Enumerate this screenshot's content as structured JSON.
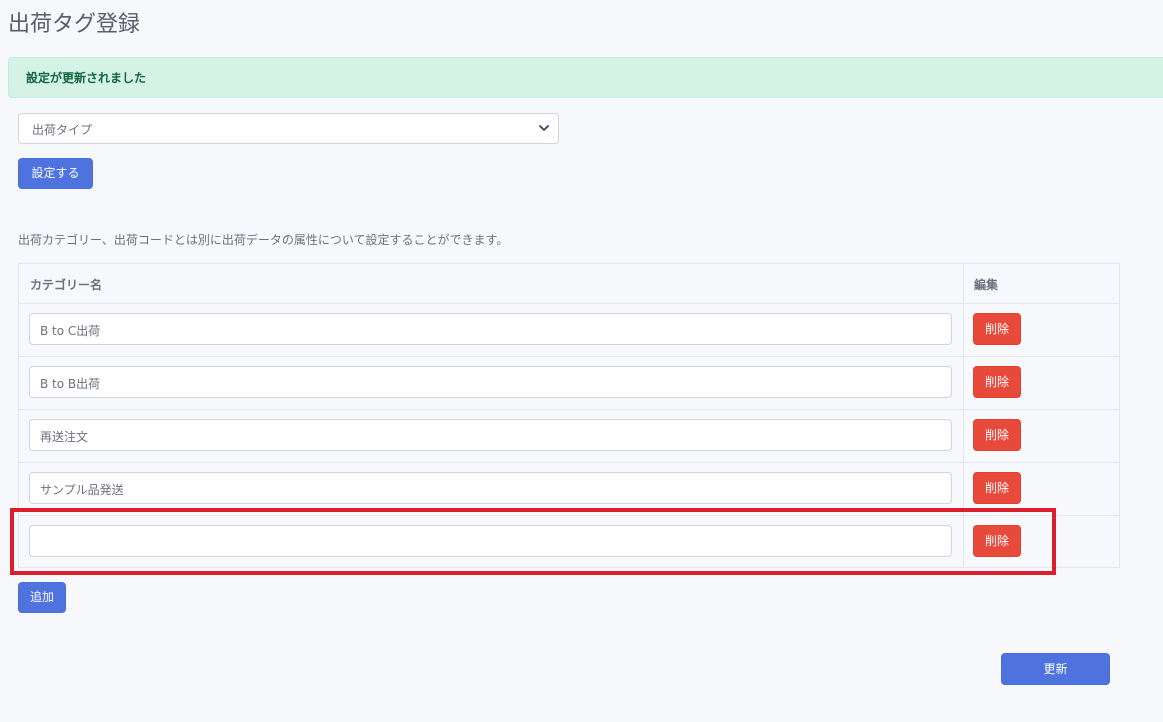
{
  "page": {
    "title": "出荷タグ登録"
  },
  "alert": {
    "message": "設定が更新されました"
  },
  "select": {
    "selected": "出荷タイプ"
  },
  "buttons": {
    "set": "設定する",
    "add": "追加",
    "update": "更新"
  },
  "description": "出荷カテゴリー、出荷コードとは別に出荷データの属性について設定することができます。",
  "table": {
    "headers": {
      "name": "カテゴリー名",
      "edit": "編集"
    },
    "rows": [
      {
        "value": "B to C出荷",
        "delete_label": "削除"
      },
      {
        "value": "B to B出荷",
        "delete_label": "削除"
      },
      {
        "value": "再送注文",
        "delete_label": "削除"
      },
      {
        "value": "サンプル品発送",
        "delete_label": "削除"
      },
      {
        "value": "",
        "delete_label": "削除"
      }
    ]
  },
  "colors": {
    "primary": "#4e73df",
    "danger": "#e74a3b",
    "alert_bg": "#d4f3e6",
    "highlight": "#d9202c"
  }
}
